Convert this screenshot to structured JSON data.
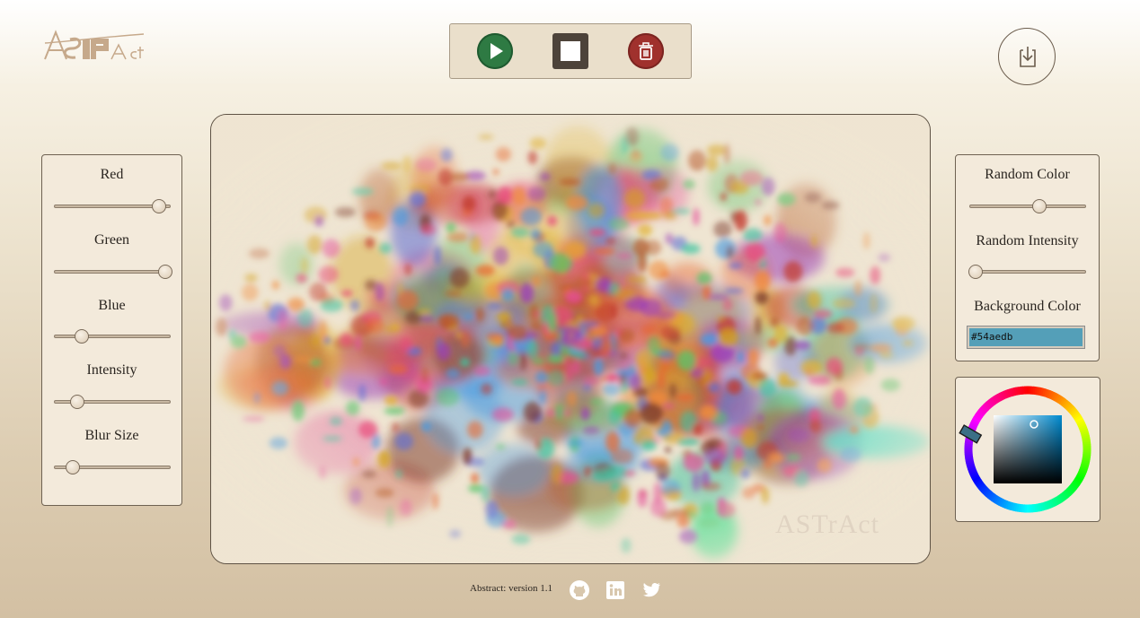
{
  "app": {
    "logo_text": "ASTrAct"
  },
  "toolbar": {
    "play_icon": "play-icon",
    "stop_icon": "stop-icon",
    "clear_icon": "trash-icon"
  },
  "download": {
    "icon": "download-icon"
  },
  "left_panel": {
    "controls": [
      {
        "label": "Red",
        "value": 0.9
      },
      {
        "label": "Green",
        "value": 0.95
      },
      {
        "label": "Blue",
        "value": 0.24
      },
      {
        "label": "Intensity",
        "value": 0.2
      },
      {
        "label": "Blur Size",
        "value": 0.16
      }
    ]
  },
  "right_panel": {
    "controls": [
      {
        "label": "Random Color",
        "value": 0.6
      },
      {
        "label": "Random Intensity",
        "value": 0.05
      }
    ],
    "background_label": "Background Color",
    "background_value": "#54aedb",
    "background_swatch": "#549fb8"
  },
  "color_picker": {
    "hue_marker_deg": 195,
    "square_base_color": "#54aedb"
  },
  "canvas": {
    "background": "#efe5d2",
    "watermark_text": "ASTrAct"
  },
  "footer": {
    "version_text": "Abstract: version 1.1",
    "icons": [
      "github-icon",
      "linkedin-icon",
      "twitter-icon"
    ]
  }
}
